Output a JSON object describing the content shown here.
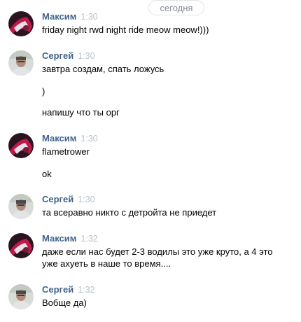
{
  "date_divider": "сегодня",
  "messages": [
    {
      "author": "Максим",
      "time": "1:30",
      "avatar": "maksim-avatar",
      "lines": [
        "friday night rwd night ride meow meow!)))"
      ]
    },
    {
      "author": "Сергей",
      "time": "1:30",
      "avatar": "sergey-avatar",
      "lines": [
        "завтра создам, спать ложусь",
        ")",
        "напишу что ты орг"
      ]
    },
    {
      "author": "Максим",
      "time": "1:30",
      "avatar": "maksim-avatar",
      "lines": [
        "flametrower",
        "ok"
      ]
    },
    {
      "author": "Сергей",
      "time": "1:30",
      "avatar": "sergey-avatar",
      "lines": [
        "та всеравно никто с детройта не приедет"
      ]
    },
    {
      "author": "Максим",
      "time": "1:32",
      "avatar": "maksim-avatar",
      "lines": [
        "даже если нас будет 2-3 водилы это уже круто, а 4 это уже ахуеть в наше то время...."
      ]
    },
    {
      "author": "Сергей",
      "time": "1:32",
      "avatar": "sergey-avatar",
      "lines": [
        "Вобще да)"
      ]
    }
  ]
}
